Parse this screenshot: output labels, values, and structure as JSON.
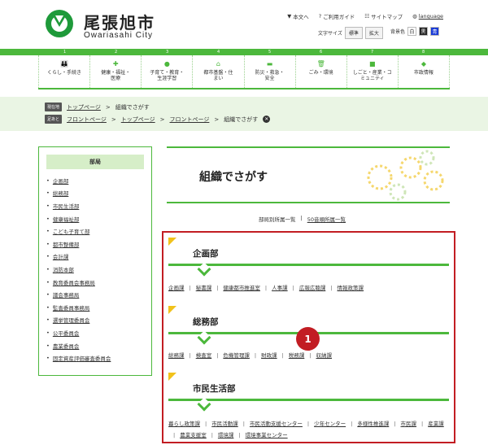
{
  "header": {
    "site_name": "尾張旭市",
    "site_sub": "Owariasahi City",
    "utility": [
      {
        "icon": "sort-down-icon",
        "label": "本文へ"
      },
      {
        "icon": "help-icon",
        "label": "ご利用ガイド"
      },
      {
        "icon": "sitemap-icon",
        "label": "サイトマップ"
      },
      {
        "icon": "globe-icon",
        "label": "language"
      }
    ],
    "font_size_label": "文字サイズ",
    "font_standard": "標準",
    "font_large": "拡大",
    "bg_label": "背景色",
    "bg_white": "白",
    "bg_black": "黒",
    "bg_blue": "青"
  },
  "nav": [
    {
      "num": "1",
      "icon": "family-icon",
      "label": "くらし・手続き"
    },
    {
      "num": "2",
      "icon": "health-icon",
      "label": "健康・福祉・医療"
    },
    {
      "num": "3",
      "icon": "education-icon",
      "label": "子育て・教育・生涯学習"
    },
    {
      "num": "4",
      "icon": "house-icon",
      "label": "都市基盤・住まい"
    },
    {
      "num": "5",
      "icon": "safety-icon",
      "label": "防災・救急・安全"
    },
    {
      "num": "6",
      "icon": "trash-icon",
      "label": "ごみ・環境"
    },
    {
      "num": "7",
      "icon": "briefcase-icon",
      "label": "しごと・産業・コミュニティ"
    },
    {
      "num": "8",
      "icon": "city-icon",
      "label": "市政情報"
    }
  ],
  "breadcrumb": {
    "current_tag": "現在地",
    "current": [
      "トップページ",
      "組織でさがす"
    ],
    "history_tag": "足あと",
    "history": [
      "フロントページ",
      "トップページ",
      "フロントページ",
      "組織でさがす"
    ]
  },
  "sidebar": {
    "title": "部局",
    "items": [
      "企画部",
      "総務部",
      "市民生活部",
      "健康福祉部",
      "こども子育て部",
      "都市整備部",
      "会計課",
      "消防本部",
      "教育委員会事務局",
      "議会事務局",
      "監査委員事務局",
      "選挙管理委員会",
      "公平委員会",
      "農業委員会",
      "固定資産評価審査委員会"
    ]
  },
  "main": {
    "title": "組織でさがす",
    "subnav": [
      "部局別所属一覧",
      "50音順所属一覧"
    ],
    "departments": [
      {
        "name": "企画部",
        "links": [
          "企画課",
          "秘書課",
          "健康都市推進室",
          "人事課",
          "広報広聴課",
          "情報政策課"
        ]
      },
      {
        "name": "総務部",
        "links": [
          "総務課",
          "検査室",
          "危機管理課",
          "財政課",
          "税務課",
          "収納課"
        ]
      },
      {
        "name": "市民生活部",
        "links": [
          "暮らし政策課",
          "市民活動課",
          "市民活動支援センター",
          "少年センター",
          "多様性推進課",
          "市民課",
          "産業課",
          "農業支援室",
          "環境課",
          "環境事業センター"
        ]
      }
    ]
  },
  "annotation": {
    "marker": "1"
  },
  "colors": {
    "green": "#4cb83c",
    "red": "#c21d23",
    "light_green": "#eaf5e4",
    "yellow": "#f1c21b"
  }
}
